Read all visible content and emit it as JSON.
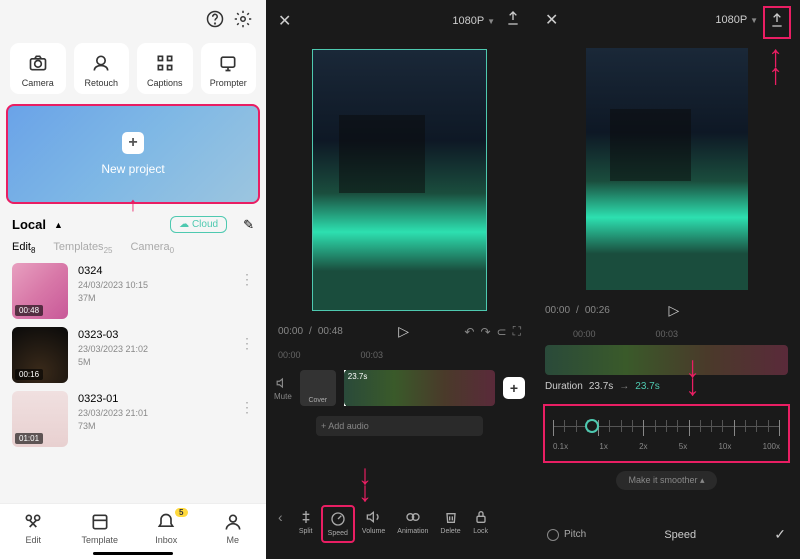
{
  "panel1": {
    "tools": {
      "camera": "Camera",
      "retouch": "Retouch",
      "captions": "Captions",
      "prompter": "Prompter"
    },
    "new_project": "New project",
    "local": "Local",
    "cloud": "Cloud",
    "tabs": {
      "edit": "Edit",
      "edit_count": "8",
      "templates": "Templates",
      "templates_count": "25",
      "camera": "Camera",
      "camera_count": "0"
    },
    "projects": [
      {
        "name": "0324",
        "date": "24/03/2023 10:15",
        "size": "37M",
        "duration": "00:48"
      },
      {
        "name": "0323-03",
        "date": "23/03/2023 21:02",
        "size": "5M",
        "duration": "00:16"
      },
      {
        "name": "0323-01",
        "date": "23/03/2023 21:01",
        "size": "73M",
        "duration": "01:01"
      }
    ],
    "nav": {
      "edit": "Edit",
      "template": "Template",
      "inbox": "Inbox",
      "inbox_badge": "5",
      "me": "Me"
    }
  },
  "panel2": {
    "resolution": "1080P",
    "time_current": "00:00",
    "time_total": "00:48",
    "ticks": {
      "t0": "00:00",
      "t1": "00:03"
    },
    "mute": "Mute",
    "cover": "Cover",
    "clip_duration": "23.7s",
    "add_audio": "+  Add audio",
    "tools": {
      "split": "Split",
      "speed": "Speed",
      "volume": "Volume",
      "animation": "Animation",
      "delete": "Delete",
      "lock": "Lock"
    }
  },
  "panel3": {
    "resolution": "1080P",
    "time_current": "00:00",
    "time_total": "00:26",
    "ticks": {
      "t0": "00:00",
      "t1": "00:03"
    },
    "duration_label": "Duration",
    "duration_orig": "23.7s",
    "duration_new": "23.7s",
    "speeds": {
      "s1": "0.1x",
      "s2": "1x",
      "s3": "2x",
      "s4": "5x",
      "s5": "10x",
      "s6": "100x"
    },
    "smoother": "Make it smoother",
    "pitch": "Pitch",
    "speed": "Speed"
  }
}
